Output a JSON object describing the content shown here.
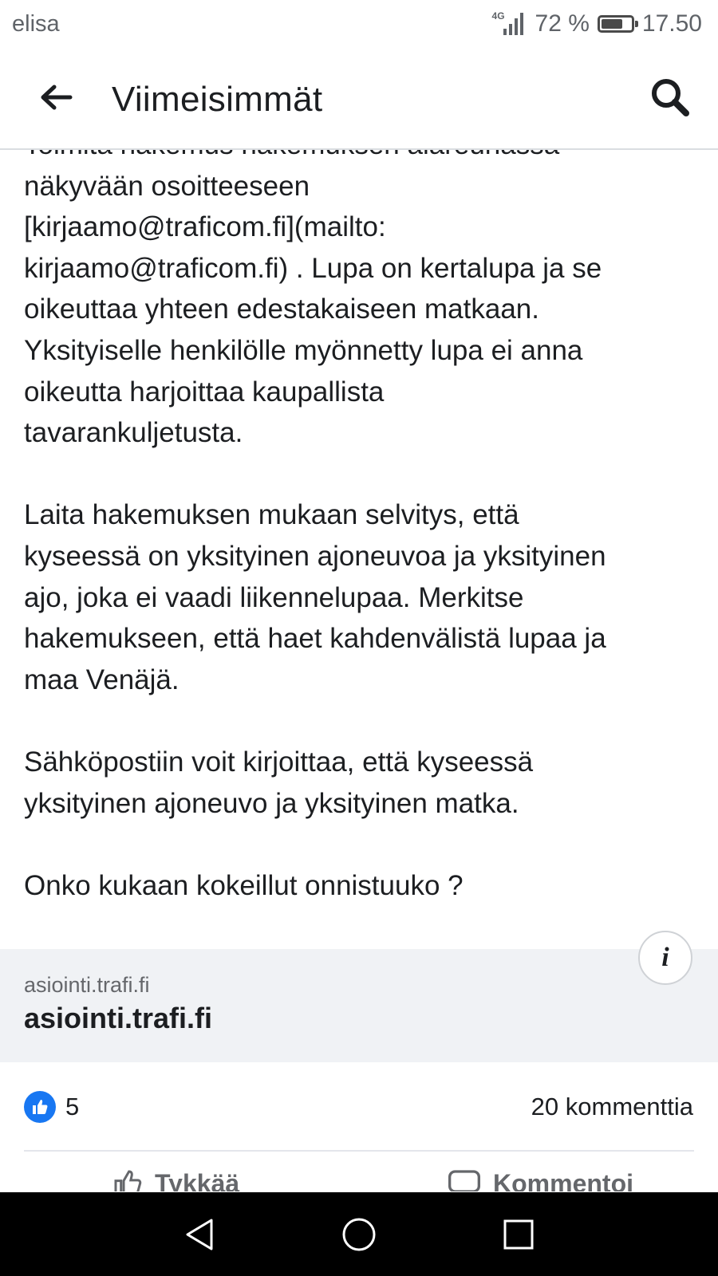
{
  "status_bar": {
    "carrier": "elisa",
    "network": "4G",
    "battery": "72 %",
    "battery_level": 0.72,
    "time": "17.50"
  },
  "header": {
    "title": "Viimeisimmät",
    "back_icon": "arrow-left-icon",
    "search_icon": "search-icon"
  },
  "post": {
    "paragraphs": [
      [
        "Toimita hakemus hakemuksen alareunassa",
        "näkyvään osoitteeseen",
        "[kirjaamo@traficom.fi](mailto:",
        "kirjaamo@traficom.fi) . Lupa on kertalupa ja se",
        "oikeuttaa yhteen edestakaiseen matkaan.",
        "Yksityiselle henkilölle myönnetty lupa ei anna",
        "oikeutta harjoittaa kaupallista",
        "tavarankuljetusta."
      ],
      [
        "Laita hakemuksen mukaan selvitys, että",
        "kyseessä on yksityinen ajoneuvoa ja yksityinen",
        "ajo, joka ei vaadi liikennelupaa. Merkitse",
        "hakemukseen, että haet kahdenvälistä lupaa ja",
        "maa Venäjä."
      ],
      [
        "Sähköpostiin voit kirjoittaa, että kyseessä",
        "yksityinen ajoneuvo ja yksityinen matka."
      ],
      [
        "Onko kukaan kokeillut onnistuuko ?"
      ]
    ]
  },
  "link_preview": {
    "domain": "asiointi.trafi.fi",
    "title": "asiointi.trafi.fi",
    "info_label": "i"
  },
  "reactions": {
    "like_count": "5",
    "comment_count": "20 kommenttia"
  },
  "actions": {
    "like_label": "Tykkää",
    "comment_label": "Kommentoi"
  },
  "colors": {
    "brand_blue": "#1877f2",
    "text": "#1c1e21",
    "secondary_text": "#65676b",
    "preview_bg": "#f0f2f5",
    "nav_bar": "#000000"
  }
}
